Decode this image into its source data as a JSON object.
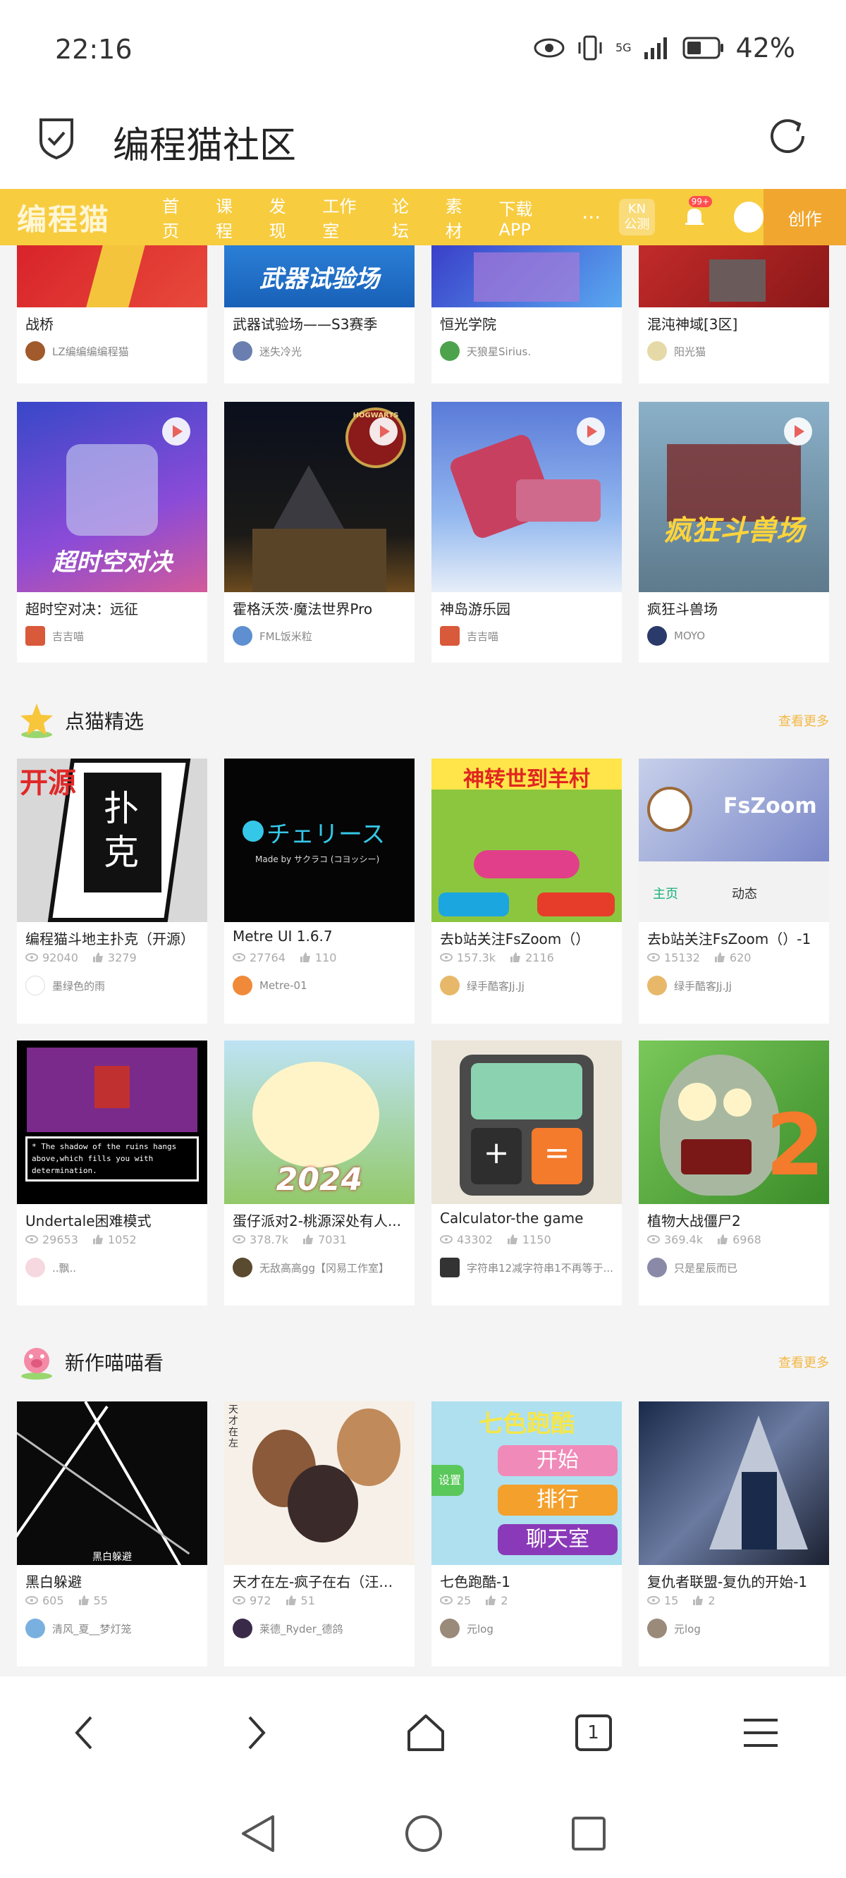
{
  "status_bar": {
    "time": "22:16",
    "network": "5G",
    "battery": "42%"
  },
  "header": {
    "title": "编程猫社区"
  },
  "site_nav": {
    "logo": "编程猫",
    "items": [
      "首页",
      "课程",
      "发现",
      "工作室",
      "论坛",
      "素材",
      "下载APP"
    ],
    "more": "···",
    "kn_badge": "KN\n公测",
    "notification_count": "99+",
    "create": "创作"
  },
  "top_row": [
    {
      "title": "战桥",
      "author": "LZ编编编编程猫"
    },
    {
      "title": "武器试验场——S3赛季",
      "author": "迷失冷光",
      "thumb_text": "武器试验场"
    },
    {
      "title": "恒光学院",
      "author": "天狼星Sirius."
    },
    {
      "title": "混沌神域[3区]",
      "author": "阳光猫"
    }
  ],
  "second_row": [
    {
      "title": "超时空对决：远征",
      "author": "吉吉喵",
      "thumb_text": "超时空对决"
    },
    {
      "title": "霍格沃茨·魔法世界Pro",
      "author": "FML饭米粒",
      "thumb_text": "HOGWARTS"
    },
    {
      "title": "神岛游乐园",
      "author": "吉吉喵"
    },
    {
      "title": "疯狂斗兽场",
      "author": "MOYO",
      "thumb_text": "疯狂斗兽场"
    }
  ],
  "section_featured": {
    "title": "点猫精选",
    "see_more": "查看更多",
    "items": [
      {
        "title": "编程猫斗地主扑克（开源）",
        "views": "92040",
        "likes": "3279",
        "author": "墨绿色的雨",
        "thumb_text_a": "开源",
        "thumb_text_b": "扑克"
      },
      {
        "title": "Metre UI 1.6.7",
        "views": "27764",
        "likes": "110",
        "author": "Metre-01",
        "thumb_text_a": "チェリース",
        "thumb_text_b": "Made by サクラコ (コヨッシー)"
      },
      {
        "title": "去b站关注FsZoom（）",
        "views": "157.3k",
        "likes": "2116",
        "author": "绿手酷客Jj.Jj",
        "thumb_text_a": "神转世到羊村"
      },
      {
        "title": "去b站关注FsZoom（）-1",
        "views": "15132",
        "likes": "620",
        "author": "绿手酷客Jj.Jj",
        "thumb_text_a": "FsZoom",
        "thumb_text_b": "主页",
        "thumb_text_c": "动态"
      }
    ],
    "items_row2": [
      {
        "title": "Undertale困难模式",
        "views": "29653",
        "likes": "1052",
        "author": "..飘..",
        "thumb_text_a": "* The shadow of the ruins hangs above,which fills you with determination."
      },
      {
        "title": "蛋仔派对2-桃源深处有人...",
        "views": "378.7k",
        "likes": "7031",
        "author": "无敌高高gg【冈易工作室】",
        "thumb_text_a": "2024"
      },
      {
        "title": "Calculator-the game",
        "views": "43302",
        "likes": "1150",
        "author": "字符串12减字符串1不再等于...",
        "thumb_text_a": "+",
        "thumb_text_b": "="
      },
      {
        "title": "植物大战僵尸2",
        "views": "369.4k",
        "likes": "6968",
        "author": "只是星辰而已",
        "thumb_text_a": "2"
      }
    ]
  },
  "section_new": {
    "title": "新作喵喵看",
    "see_more": "查看更多",
    "items": [
      {
        "title": "黑白躲避",
        "views": "605",
        "likes": "55",
        "author": "清风_夏__梦灯笼",
        "thumb_text_a": "黑白躲避"
      },
      {
        "title": "天才在左-疯子在右（汪汪...",
        "views": "972",
        "likes": "51",
        "author": "莱德_Ryder_德鸽",
        "thumb_text_a": "天才在左"
      },
      {
        "title": "七色跑酷-1",
        "views": "25",
        "likes": "2",
        "author": "元log",
        "thumb_text_a": "七色跑酷",
        "thumb_text_b": "开始",
        "thumb_text_c": "排行",
        "thumb_text_d": "聊天室",
        "thumb_text_e": "设置"
      },
      {
        "title": "复仇者联盟-复仇的开始-1",
        "views": "15",
        "likes": "2",
        "author": "元log"
      }
    ]
  },
  "colors": {
    "accent": "#f7cc3f",
    "create": "#f1a62f",
    "see_more": "#f3b844"
  }
}
